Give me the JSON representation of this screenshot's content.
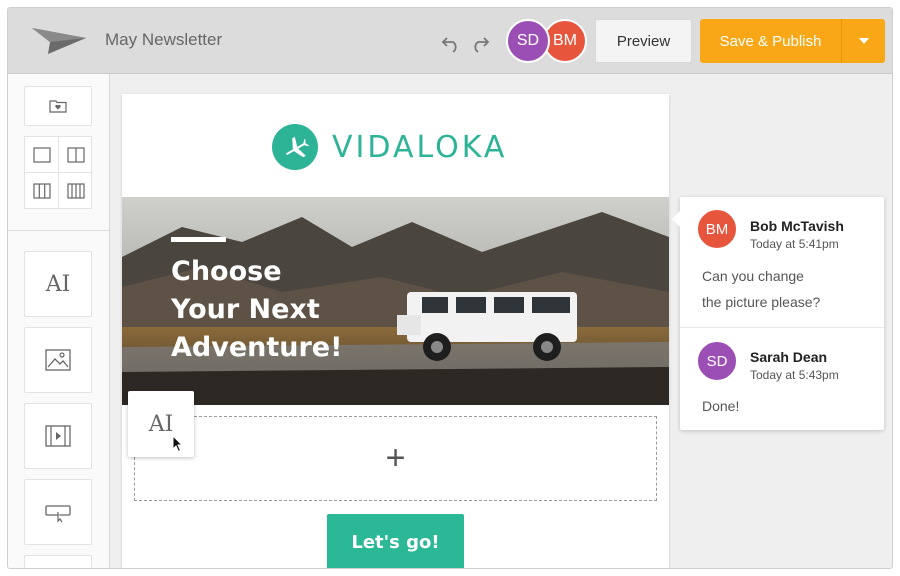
{
  "header": {
    "title": "May Newsletter",
    "collaborators": [
      {
        "initials": "SD",
        "color": "#9b4fb5"
      },
      {
        "initials": "BM",
        "color": "#e8553d"
      }
    ],
    "preview_label": "Preview",
    "publish_label": "Save & Publish"
  },
  "sidebar": {
    "text_tool_glyph": "AI"
  },
  "email": {
    "brand_name": "VIDALOKA",
    "hero_lines": [
      "Choose",
      "Your Next",
      "Adventure!"
    ],
    "dropzone_glyph": "+",
    "dragging_glyph": "AI",
    "cta_label": "Let's go!"
  },
  "comments": [
    {
      "initials": "BM",
      "name": "Bob McTavish",
      "time": "Today at 5:41pm",
      "body_lines": [
        "Can you change",
        "the picture please?"
      ],
      "color": "#e8553d"
    },
    {
      "initials": "SD",
      "name": "Sarah Dean",
      "time": "Today at 5:43pm",
      "body_lines": [
        "Done!"
      ],
      "color": "#9b4fb5"
    }
  ],
  "colors": {
    "accent": "#2db396",
    "publish": "#f9a717"
  }
}
